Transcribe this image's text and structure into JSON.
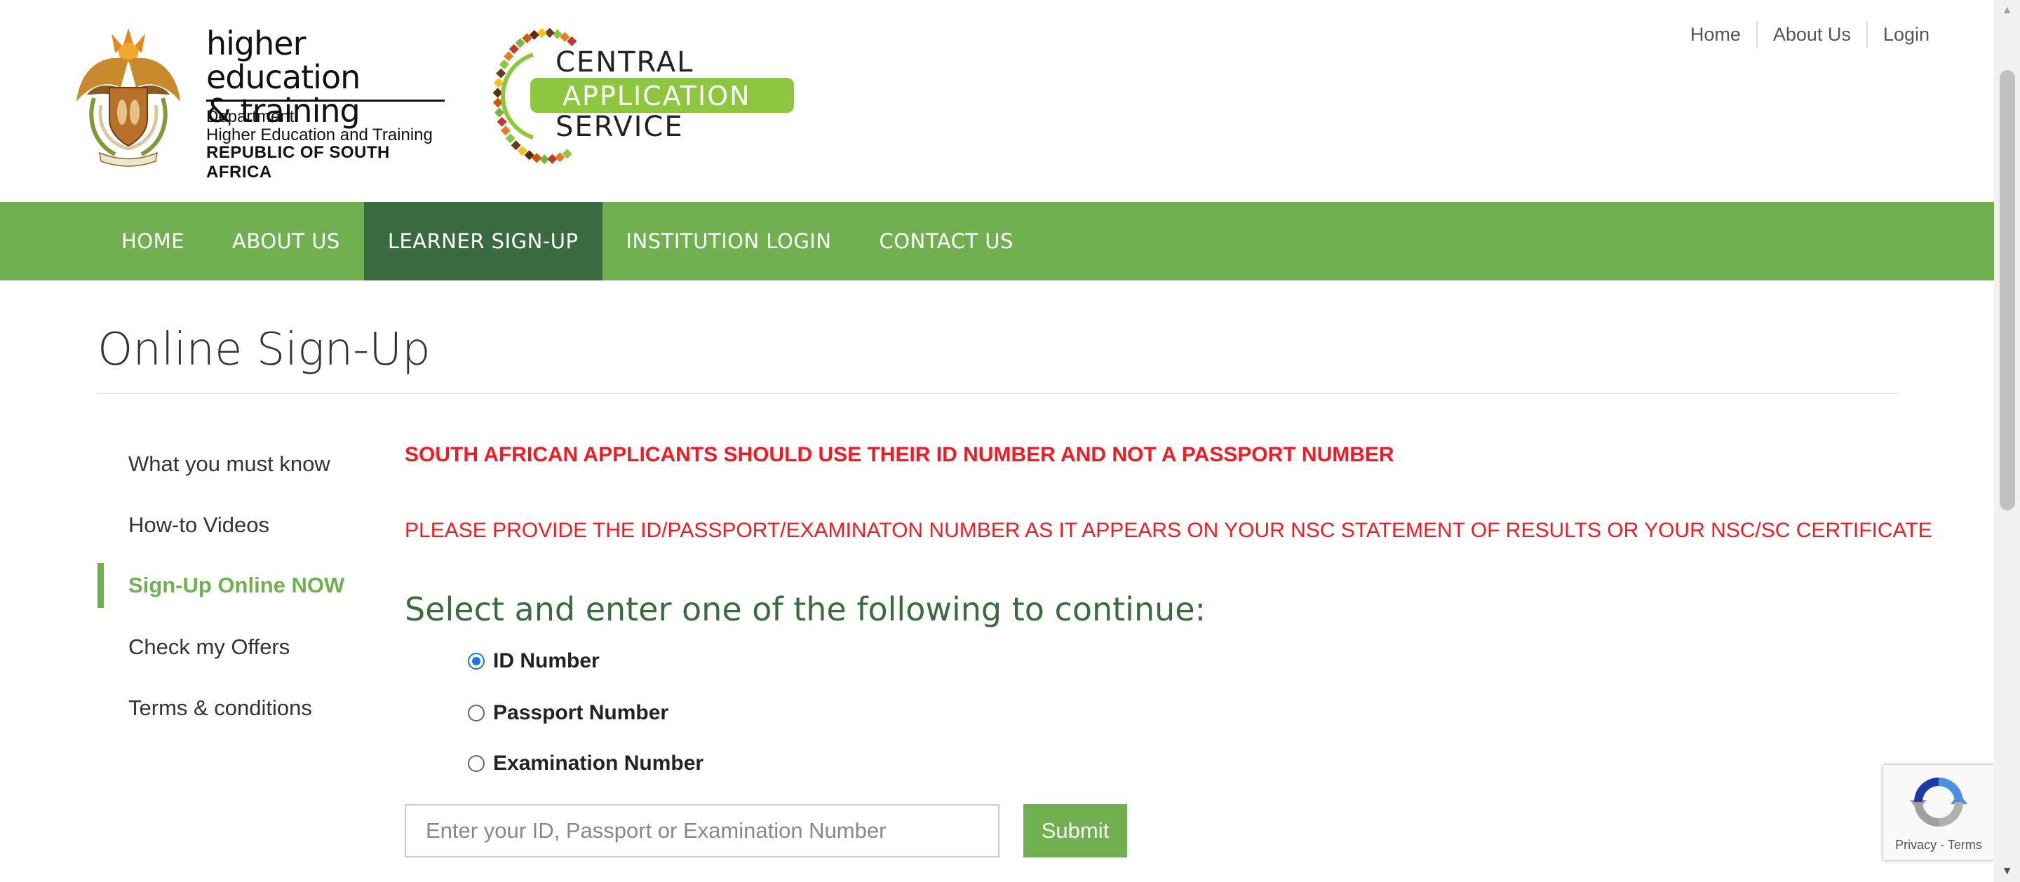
{
  "header": {
    "dhet_logo": {
      "title_line1": "higher education",
      "title_line2": "& training",
      "dept_line1": "Department:",
      "dept_line2": "Higher Education and Training",
      "country": "REPUBLIC OF SOUTH AFRICA"
    },
    "cas_logo": {
      "line1": "CENTRAL",
      "line2": "APPLICATION",
      "line3": "SERVICE"
    },
    "top_links": [
      "Home",
      "About Us",
      "Login"
    ]
  },
  "nav": {
    "items": [
      {
        "label": "HOME"
      },
      {
        "label": "ABOUT US"
      },
      {
        "label": "LEARNER SIGN-UP",
        "active": true
      },
      {
        "label": "INSTITUTION LOGIN"
      },
      {
        "label": "CONTACT US"
      }
    ]
  },
  "page": {
    "title": "Online Sign-Up"
  },
  "sidebar": {
    "items": [
      {
        "label": "What you must know"
      },
      {
        "label": "How-to Videos"
      },
      {
        "label": "Sign-Up Online NOW",
        "active": true
      },
      {
        "label": "Check my Offers"
      },
      {
        "label": "Terms & conditions"
      }
    ]
  },
  "content": {
    "warning_bold": "SOUTH AFRICAN APPLICANTS SHOULD USE THEIR ID NUMBER AND NOT A PASSPORT NUMBER",
    "warning_regular": "PLEASE PROVIDE THE ID/PASSPORT/EXAMINATON NUMBER AS IT APPEARS ON YOUR NSC STATEMENT OF RESULTS OR YOUR NSC/SC CERTIFICATE",
    "select_heading": "Select and enter one of the following to continue:",
    "options": [
      {
        "label": "ID Number",
        "checked": true
      },
      {
        "label": "Passport Number",
        "checked": false
      },
      {
        "label": "Examination Number",
        "checked": false
      }
    ],
    "input_placeholder": "Enter your ID, Passport or Examination Number",
    "input_value": "",
    "submit_label": "Submit"
  },
  "recaptcha": {
    "privacy": "Privacy",
    "separator": "-",
    "terms": "Terms"
  },
  "colors": {
    "brand_green": "#70b051",
    "nav_active": "#3a6b3e",
    "warning_red": "#ee1c24",
    "heading_green": "#3a6b3e"
  },
  "icons": [
    "coat-of-arms-icon",
    "cas-logo-icon",
    "recaptcha-icon",
    "scroll-up-arrow-icon",
    "scroll-down-arrow-icon"
  ]
}
